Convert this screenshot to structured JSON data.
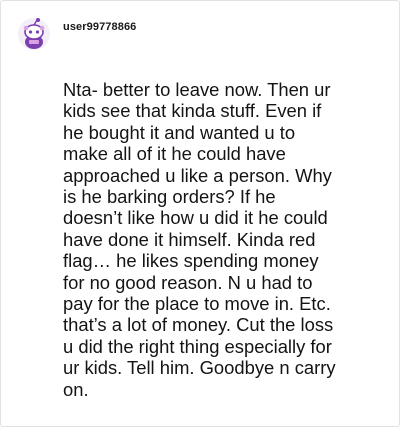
{
  "comment": {
    "username": "user99778866",
    "avatar_icon": "reddit-snoo-avatar-icon",
    "lines": [
      "Nta- better to leave now. Then ur",
      "kids see that kinda stuff. Even if",
      "he bought it and wanted u to",
      "make all of it he could have",
      "approached u like a person. Why",
      "is he barking orders? If he",
      "doesn’t like how u did it he could",
      "have done it himself. Kinda red",
      "flag… he likes spending money",
      "for no good reason. N u had to",
      "pay for the place to move in. Etc.",
      "that’s a lot of money. Cut the loss",
      "u did the right thing especially for",
      "ur kids. Tell him. Goodbye n carry",
      "on."
    ]
  },
  "colors": {
    "avatar_purple": "#7b3fb0",
    "avatar_pink": "#d9a3e6",
    "text": "#141414",
    "border": "#e2e2e2"
  }
}
